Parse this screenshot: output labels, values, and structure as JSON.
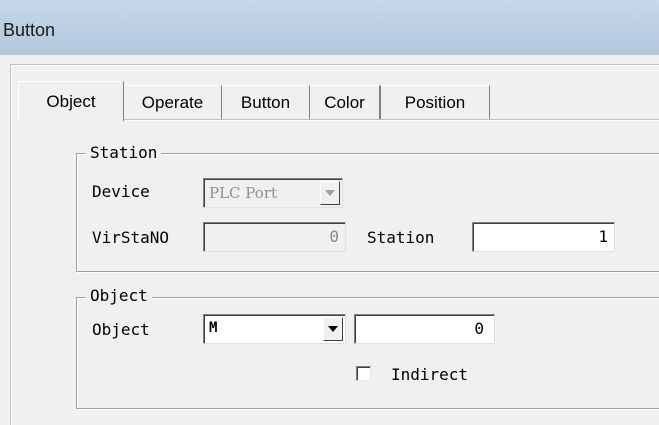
{
  "window": {
    "title": "Button"
  },
  "tabs": [
    {
      "label": "Object",
      "active": true
    },
    {
      "label": "Operate"
    },
    {
      "label": "Button"
    },
    {
      "label": "Color"
    },
    {
      "label": "Position"
    }
  ],
  "station_group": {
    "title": "Station",
    "device_label": "Device",
    "device_value": "PLC Port",
    "virstano_label": "VirStaNO",
    "virstano_value": "0",
    "station_label": "Station",
    "station_value": "1"
  },
  "object_group": {
    "title": "Object",
    "object_label": "Object",
    "object_type": "M",
    "object_value": "0",
    "indirect_label": "Indirect",
    "indirect_checked": false
  }
}
